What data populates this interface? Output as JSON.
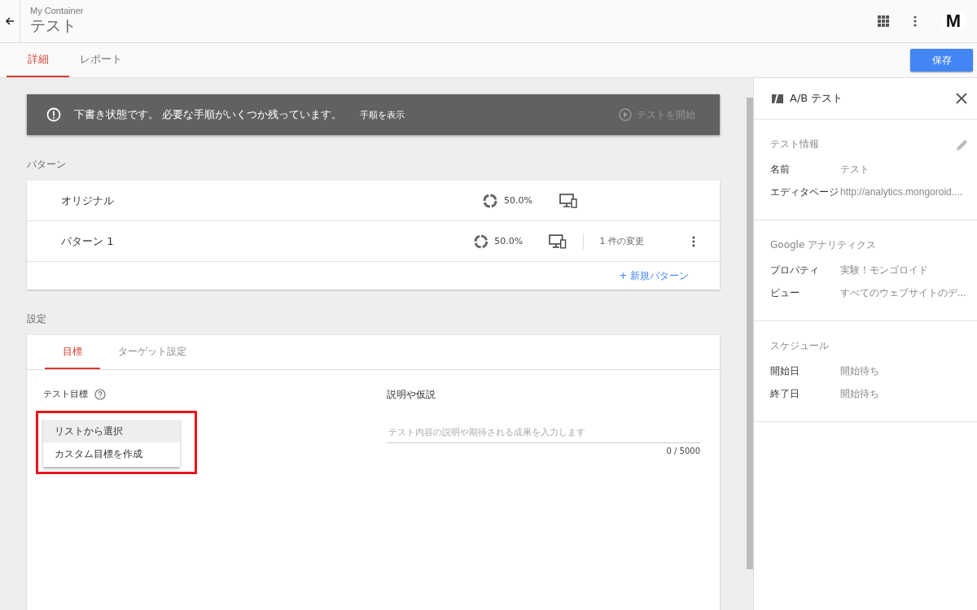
{
  "header": {
    "container": "My Container",
    "title": "テスト",
    "avatar": "M"
  },
  "tabs": [
    {
      "label": "詳細",
      "selected": true
    },
    {
      "label": "レポート",
      "selected": false
    }
  ],
  "save_button": "保存",
  "banner": {
    "message": "下書き状態です。 必要な手順がいくつか残っています。",
    "link": "手順を表示",
    "action": "テストを開始"
  },
  "patterns": {
    "heading": "パターン",
    "rows": [
      {
        "name": "オリジナル",
        "weight": "50.0%",
        "changes": ""
      },
      {
        "name": "パターン 1",
        "weight": "50.0%",
        "changes": "1 件の変更"
      }
    ],
    "add": "+ 新規パターン"
  },
  "settings": {
    "heading": "設定",
    "tabs": [
      {
        "label": "目標",
        "selected": true
      },
      {
        "label": "ターゲット設定",
        "selected": false
      }
    ],
    "goal_label": "テスト目標",
    "menu": [
      {
        "label": "リストから選択",
        "selected": true
      },
      {
        "label": "カスタム目標を作成",
        "selected": false
      }
    ],
    "description_label": "説明や仮説",
    "description": {
      "placeholder": "テスト内容の説明や期待される成果を入力します",
      "counter": "0 / 5000"
    }
  },
  "panel": {
    "title": "A/B テスト",
    "sections": [
      {
        "heading": "テスト情報",
        "editable": true,
        "rows": [
          {
            "label": "名前",
            "value": "テスト"
          },
          {
            "label": "エディタページ",
            "value": "http://analytics.mongoroid...."
          }
        ]
      },
      {
        "heading": "Google アナリティクス",
        "editable": false,
        "rows": [
          {
            "label": "プロパティ",
            "value": "実験！モンゴロイド"
          },
          {
            "label": "ビュー",
            "value": "すべてのウェブサイトのデ..."
          }
        ]
      },
      {
        "heading": "スケジュール",
        "editable": false,
        "rows": [
          {
            "label": "開始日",
            "value": "開始待ち"
          },
          {
            "label": "終了日",
            "value": "開始待ち"
          }
        ]
      }
    ]
  }
}
